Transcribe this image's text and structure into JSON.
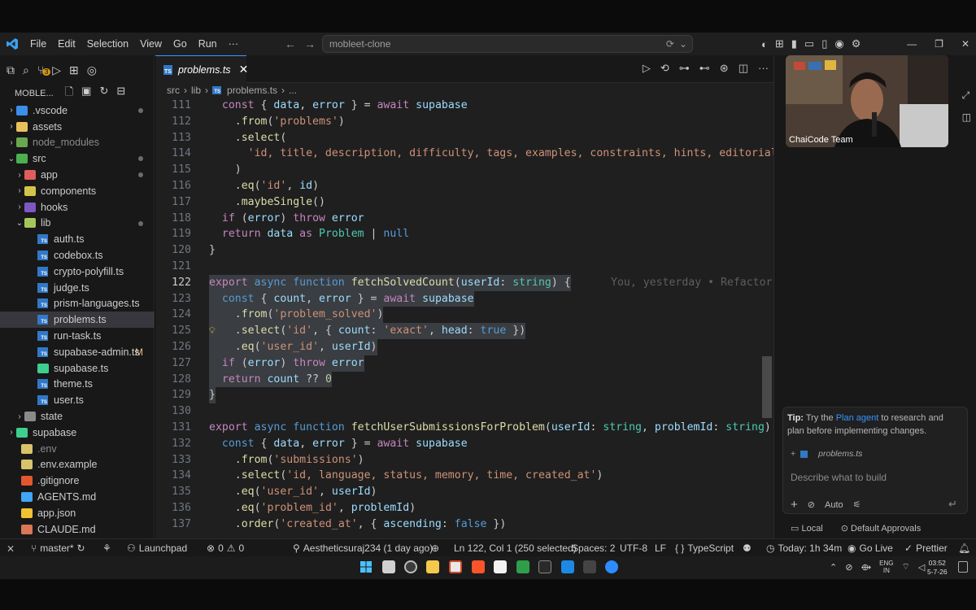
{
  "titlebar": {
    "menus": [
      "File",
      "Edit",
      "Selection",
      "View",
      "Go",
      "Run",
      "···"
    ],
    "search": "mobleet-clone"
  },
  "explorer": {
    "title": "MOBLE...",
    "git_badge": "3",
    "items": [
      {
        "label": ".vscode",
        "chev": "›",
        "icon": "folder-vscode",
        "indent": 0
      },
      {
        "label": "assets",
        "chev": "›",
        "icon": "folder",
        "indent": 0
      },
      {
        "label": "node_modules",
        "chev": "›",
        "icon": "folder-node",
        "indent": 0
      },
      {
        "label": "src",
        "chev": "⌄",
        "icon": "folder-src",
        "indent": 0
      },
      {
        "label": "app",
        "chev": "›",
        "icon": "folder-app",
        "indent": 1
      },
      {
        "label": "components",
        "chev": "›",
        "icon": "folder-components",
        "indent": 1
      },
      {
        "label": "hooks",
        "chev": "›",
        "icon": "folder-hooks",
        "indent": 1
      },
      {
        "label": "lib",
        "chev": "⌄",
        "icon": "folder-lib",
        "indent": 1
      },
      {
        "label": "auth.ts",
        "icon": "ts-file",
        "indent": 2
      },
      {
        "label": "codebox.ts",
        "icon": "ts-file",
        "indent": 2
      },
      {
        "label": "crypto-polyfill.ts",
        "icon": "ts-file",
        "indent": 2
      },
      {
        "label": "judge.ts",
        "icon": "ts-file",
        "indent": 2
      },
      {
        "label": "prism-languages.ts",
        "icon": "ts-file",
        "indent": 2
      },
      {
        "label": "problems.ts",
        "icon": "ts-file",
        "indent": 2
      },
      {
        "label": "run-task.ts",
        "icon": "ts-file",
        "indent": 2
      },
      {
        "label": "supabase-admin.ts",
        "icon": "ts-file",
        "indent": 2,
        "badge": "M"
      },
      {
        "label": "supabase.ts",
        "icon": "supabase-file",
        "indent": 2
      },
      {
        "label": "theme.ts",
        "icon": "ts-file",
        "indent": 2
      },
      {
        "label": "user.ts",
        "icon": "ts-file",
        "indent": 2
      },
      {
        "label": "state",
        "chev": "›",
        "icon": "folder-state",
        "indent": 1
      },
      {
        "label": "supabase",
        "chev": "›",
        "icon": "folder-supabase",
        "indent": 0
      },
      {
        "label": ".env",
        "icon": "env-file",
        "indent": 0
      },
      {
        "label": ".env.example",
        "icon": "env-file",
        "indent": 0
      },
      {
        "label": ".gitignore",
        "icon": "git-file",
        "indent": 0
      },
      {
        "label": "AGENTS.md",
        "icon": "md-file",
        "indent": 0
      },
      {
        "label": "app.json",
        "icon": "json-file",
        "indent": 0
      },
      {
        "label": "CLAUDE.md",
        "icon": "claude-file",
        "indent": 0
      }
    ]
  },
  "tab": {
    "name": "problems.ts",
    "close": "✕"
  },
  "breadcrumb": [
    "src",
    "lib",
    "problems.ts",
    "..."
  ],
  "editor": {
    "blame": "You, yesterday • Refactor",
    "lines": [
      {
        "n": "111",
        "c": [
          [
            "k",
            "  const "
          ],
          [
            "",
            "{ "
          ],
          [
            "v",
            "data"
          ],
          [
            "",
            ", "
          ],
          [
            "v",
            "error"
          ],
          [
            "",
            " } = "
          ],
          [
            "k",
            "await "
          ],
          [
            "v",
            "supabase"
          ]
        ]
      },
      {
        "n": "112",
        "c": [
          [
            "",
            "    ."
          ],
          [
            "fn",
            "from"
          ],
          [
            "",
            "("
          ],
          [
            "s",
            "'problems'"
          ],
          [
            "",
            ")"
          ]
        ]
      },
      {
        "n": "113",
        "c": [
          [
            "",
            "    ."
          ],
          [
            "fn",
            "select"
          ],
          [
            "",
            "("
          ]
        ]
      },
      {
        "n": "114",
        "c": [
          [
            "s",
            "      'id, title, description, difficulty, tags, examples, constraints, hints, editorial"
          ]
        ]
      },
      {
        "n": "115",
        "c": [
          [
            "",
            "    )"
          ]
        ]
      },
      {
        "n": "116",
        "c": [
          [
            "",
            "    ."
          ],
          [
            "fn",
            "eq"
          ],
          [
            "",
            "("
          ],
          [
            "s",
            "'id'"
          ],
          [
            "",
            ", "
          ],
          [
            "v",
            "id"
          ],
          [
            "",
            ")"
          ]
        ]
      },
      {
        "n": "117",
        "c": [
          [
            "",
            "    ."
          ],
          [
            "fn",
            "maybeSingle"
          ],
          [
            "",
            "()"
          ]
        ]
      },
      {
        "n": "118",
        "c": [
          [
            "k",
            "  if "
          ],
          [
            "",
            "("
          ],
          [
            "v",
            "error"
          ],
          [
            "",
            ") "
          ],
          [
            "k",
            "throw "
          ],
          [
            "v",
            "error"
          ]
        ]
      },
      {
        "n": "119",
        "c": [
          [
            "k",
            "  return "
          ],
          [
            "v",
            "data"
          ],
          [
            "k",
            " as "
          ],
          [
            "t",
            "Problem"
          ],
          [
            "",
            " | "
          ],
          [
            "kb",
            "null"
          ]
        ]
      },
      {
        "n": "120",
        "c": [
          [
            "",
            "}"
          ]
        ]
      },
      {
        "n": "121",
        "c": [
          [
            "",
            ""
          ]
        ]
      },
      {
        "n": "122",
        "cur": true,
        "hl": true,
        "blame": true,
        "c": [
          [
            "k",
            "export "
          ],
          [
            "kb",
            "async "
          ],
          [
            "kb",
            "function "
          ],
          [
            "fn",
            "fetchSolvedCount"
          ],
          [
            "",
            "("
          ],
          [
            "v",
            "userId"
          ],
          [
            "",
            ": "
          ],
          [
            "t",
            "string"
          ],
          [
            "",
            ") {"
          ]
        ]
      },
      {
        "n": "123",
        "hl": true,
        "c": [
          [
            "kb",
            "  const "
          ],
          [
            "",
            "{ "
          ],
          [
            "v",
            "count"
          ],
          [
            "",
            ", "
          ],
          [
            "v",
            "error"
          ],
          [
            "",
            " } = "
          ],
          [
            "k",
            "await "
          ],
          [
            "v",
            "supabase"
          ]
        ]
      },
      {
        "n": "124",
        "hl": true,
        "c": [
          [
            "",
            "    ."
          ],
          [
            "fn",
            "from"
          ],
          [
            "",
            "("
          ],
          [
            "s",
            "'problem_solved'"
          ],
          [
            "",
            ")"
          ]
        ]
      },
      {
        "n": "125",
        "hl": true,
        "c": [
          [
            "",
            "    ."
          ],
          [
            "fn",
            "select"
          ],
          [
            "",
            "("
          ],
          [
            "s",
            "'id'"
          ],
          [
            "",
            ", { "
          ],
          [
            "v",
            "count"
          ],
          [
            "",
            ": "
          ],
          [
            "s",
            "'exact'"
          ],
          [
            "",
            ", "
          ],
          [
            "v",
            "head"
          ],
          [
            "",
            ": "
          ],
          [
            "kb",
            "true"
          ],
          [
            "",
            " })"
          ]
        ]
      },
      {
        "n": "126",
        "hl": true,
        "c": [
          [
            "",
            "    ."
          ],
          [
            "fn",
            "eq"
          ],
          [
            "",
            "("
          ],
          [
            "s",
            "'user_id'"
          ],
          [
            "",
            ", "
          ],
          [
            "v",
            "userId"
          ],
          [
            "",
            ")"
          ]
        ]
      },
      {
        "n": "127",
        "hl": true,
        "c": [
          [
            "k",
            "  if "
          ],
          [
            "",
            "("
          ],
          [
            "v",
            "error"
          ],
          [
            "",
            ") "
          ],
          [
            "k",
            "throw "
          ],
          [
            "v",
            "error"
          ]
        ]
      },
      {
        "n": "128",
        "hl": true,
        "c": [
          [
            "k",
            "  return "
          ],
          [
            "v",
            "count"
          ],
          [
            "",
            " ?? "
          ],
          [
            "n",
            "0"
          ]
        ]
      },
      {
        "n": "129",
        "hl": true,
        "c": [
          [
            "",
            "}"
          ]
        ]
      },
      {
        "n": "130",
        "c": [
          [
            "",
            ""
          ]
        ]
      },
      {
        "n": "131",
        "c": [
          [
            "k",
            "export "
          ],
          [
            "kb",
            "async "
          ],
          [
            "kb",
            "function "
          ],
          [
            "fn",
            "fetchUserSubmissionsForProblem"
          ],
          [
            "",
            "("
          ],
          [
            "v",
            "userId"
          ],
          [
            "",
            ": "
          ],
          [
            "t",
            "string"
          ],
          [
            "",
            ", "
          ],
          [
            "v",
            "problemId"
          ],
          [
            "",
            ": "
          ],
          [
            "t",
            "string"
          ],
          [
            "",
            ")"
          ]
        ]
      },
      {
        "n": "132",
        "c": [
          [
            "kb",
            "  const "
          ],
          [
            "",
            "{ "
          ],
          [
            "v",
            "data"
          ],
          [
            "",
            ", "
          ],
          [
            "v",
            "error"
          ],
          [
            "",
            " } = "
          ],
          [
            "k",
            "await "
          ],
          [
            "v",
            "supabase"
          ]
        ]
      },
      {
        "n": "133",
        "c": [
          [
            "",
            "    ."
          ],
          [
            "fn",
            "from"
          ],
          [
            "",
            "("
          ],
          [
            "s",
            "'submissions'"
          ],
          [
            "",
            ")"
          ]
        ]
      },
      {
        "n": "134",
        "c": [
          [
            "",
            "    ."
          ],
          [
            "fn",
            "select"
          ],
          [
            "",
            "("
          ],
          [
            "s",
            "'id, language, status, memory, time, created_at'"
          ],
          [
            "",
            ")"
          ]
        ]
      },
      {
        "n": "135",
        "c": [
          [
            "",
            "    ."
          ],
          [
            "fn",
            "eq"
          ],
          [
            "",
            "("
          ],
          [
            "s",
            "'user_id'"
          ],
          [
            "",
            ", "
          ],
          [
            "v",
            "userId"
          ],
          [
            "",
            ")"
          ]
        ]
      },
      {
        "n": "136",
        "c": [
          [
            "",
            "    ."
          ],
          [
            "fn",
            "eq"
          ],
          [
            "",
            "("
          ],
          [
            "s",
            "'problem_id'"
          ],
          [
            "",
            ", "
          ],
          [
            "v",
            "problemId"
          ],
          [
            "",
            ")"
          ]
        ]
      },
      {
        "n": "137",
        "c": [
          [
            "",
            "    ."
          ],
          [
            "fn",
            "order"
          ],
          [
            "",
            "("
          ],
          [
            "s",
            "'created_at'"
          ],
          [
            "",
            ", { "
          ],
          [
            "v",
            "ascending"
          ],
          [
            "",
            ": "
          ],
          [
            "kb",
            "false"
          ],
          [
            "",
            " })"
          ]
        ]
      }
    ]
  },
  "webcam": {
    "label": "ChaiCode Team"
  },
  "chat": {
    "tip_bold": "Tip:",
    "tip_pre": " Try the ",
    "tip_link": "Plan agent",
    "tip_post": " to research and plan before implementing changes.",
    "context_file": "problems.ts",
    "placeholder": "Describe what to build",
    "mode": "Auto",
    "local": "Local",
    "approvals": "Default Approvals"
  },
  "status": {
    "branch": "master*",
    "launchpad": "Launchpad",
    "errors": "0",
    "warnings": "0",
    "blame": "Aestheticsuraj234 (1 day ago)",
    "position": "Ln 122, Col 1 (250 selected)",
    "spaces": "Spaces: 2",
    "encoding": "UTF-8",
    "eol": "LF",
    "language": "TypeScript",
    "today": "Today: 1h 34m",
    "golive": "Go Live",
    "prettier": "Prettier"
  },
  "tray": {
    "lang": "ENG",
    "region": "IN",
    "time": "03:52",
    "date": "5-7-26"
  },
  "colors": {
    "accent": "#3794ff",
    "statusbar": "#181818",
    "editor_bg": "#1f1f1f"
  }
}
